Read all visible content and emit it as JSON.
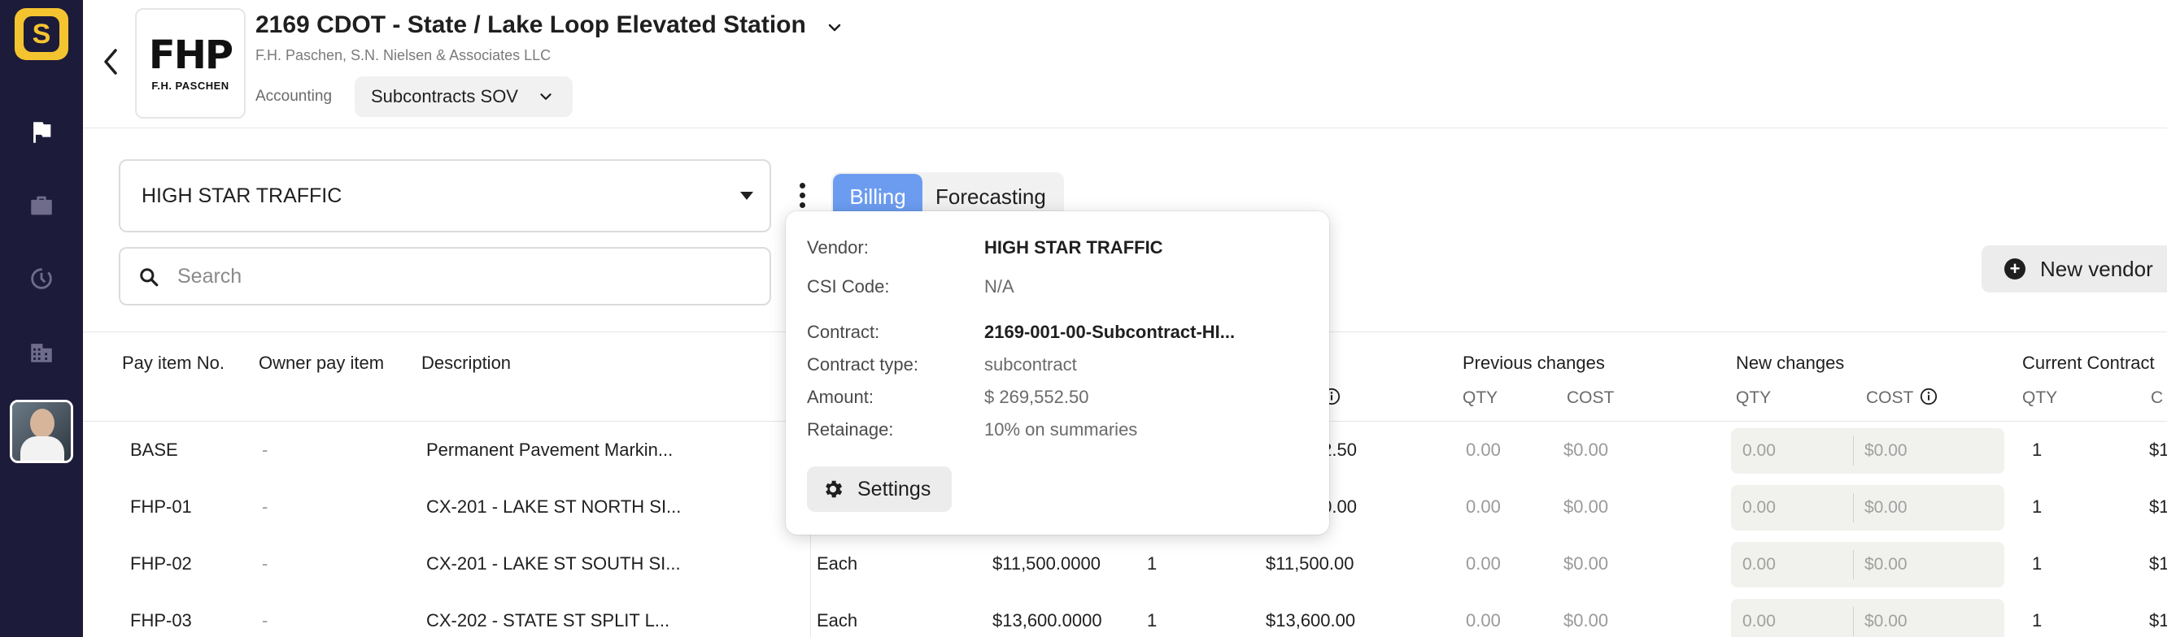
{
  "app": {
    "logo_letter": "S",
    "brand_color": "#f4c430",
    "rail_color": "#1d1b3a"
  },
  "rail": {
    "items": [
      {
        "name": "flag-icon",
        "active": true
      },
      {
        "name": "briefcase-icon",
        "active": false
      },
      {
        "name": "history-icon",
        "active": false
      },
      {
        "name": "building-icon",
        "active": false
      }
    ]
  },
  "header": {
    "company_logo_mark": "FHP",
    "company_logo_sub": "F.H. PASCHEN",
    "project_title": "2169 CDOT - State / Lake Loop Elevated Station",
    "project_subtitle": "F.H. Paschen, S.N. Nielsen & Associates LLC",
    "section_label": "Accounting",
    "module_select": "Subcontracts SOV"
  },
  "controls": {
    "vendor_select": "HIGH STAR TRAFFIC",
    "tabs": [
      {
        "label": "Billing",
        "active": true
      },
      {
        "label": "Forecasting",
        "active": false
      }
    ],
    "search_placeholder": "Search",
    "new_vendor_label": "New vendor",
    "accent_color": "#6c9cf0"
  },
  "table": {
    "headers": {
      "pay_item_no": "Pay item No.",
      "owner_pay_item": "Owner pay item",
      "description": "Description",
      "previous_changes": "Previous changes",
      "new_changes": "New changes",
      "current_contract": "Current Contract"
    },
    "subheaders": {
      "prev_qty": "QTY",
      "prev_cost": "COST",
      "new_qty": "QTY",
      "new_cost": "COST",
      "cur_qty": "QTY",
      "cur_cost_partial": "C"
    },
    "rows": [
      {
        "pay_item": "BASE",
        "owner": "-",
        "description": "Permanent Pavement Markin...",
        "unit": "",
        "unit_price": "",
        "qty": "",
        "total": "2.50",
        "prev_qty": "0.00",
        "prev_cost": "$0.00",
        "new_qty": "0.00",
        "new_cost": "$0.00",
        "cur_qty": "1",
        "cur_cost": "$1"
      },
      {
        "pay_item": "FHP-01",
        "owner": "-",
        "description": "CX-201 - LAKE ST NORTH SI...",
        "unit": "",
        "unit_price": "",
        "qty": "",
        "total": "0.00",
        "prev_qty": "0.00",
        "prev_cost": "$0.00",
        "new_qty": "0.00",
        "new_cost": "$0.00",
        "cur_qty": "1",
        "cur_cost": "$1"
      },
      {
        "pay_item": "FHP-02",
        "owner": "-",
        "description": "CX-201 - LAKE ST SOUTH SI...",
        "unit": "Each",
        "unit_price": "$11,500.0000",
        "qty": "1",
        "total": "$11,500.00",
        "prev_qty": "0.00",
        "prev_cost": "$0.00",
        "new_qty": "0.00",
        "new_cost": "$0.00",
        "cur_qty": "1",
        "cur_cost": "$1"
      },
      {
        "pay_item": "FHP-03",
        "owner": "-",
        "description": "CX-202 - STATE ST SPLIT L...",
        "unit": "Each",
        "unit_price": "$13,600.0000",
        "qty": "1",
        "total": "$13,600.00",
        "prev_qty": "0.00",
        "prev_cost": "$0.00",
        "new_qty": "0.00",
        "new_cost": "$0.00",
        "cur_qty": "1",
        "cur_cost": "$1"
      }
    ]
  },
  "popover": {
    "vendor_label": "Vendor:",
    "vendor_value": "HIGH STAR TRAFFIC",
    "csi_label": "CSI Code:",
    "csi_value": "N/A",
    "contract_label": "Contract:",
    "contract_value": "2169-001-00-Subcontract-HI...",
    "type_label": "Contract type:",
    "type_value": "subcontract",
    "amount_label": "Amount:",
    "amount_value": "$ 269,552.50",
    "retainage_label": "Retainage:",
    "retainage_value": "10% on summaries",
    "settings_label": "Settings"
  }
}
